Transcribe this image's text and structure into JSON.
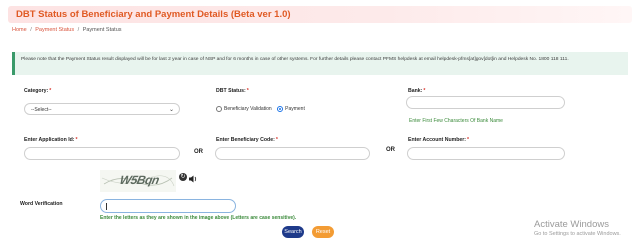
{
  "page": {
    "title": "DBT Status of Beneficiary and Payment Details (Beta ver 1.0)"
  },
  "breadcrumb": {
    "items": [
      "Home",
      "Payment Status",
      "Payment Status"
    ],
    "separator": "/"
  },
  "notice": {
    "text": "Please note that the Payment Status result displayed will be for last 2 year in case of NSP and for 6 months in case of other systems. For further details please contact PFMS helpdesk at email helpdesk-pfms[at]gov[dot]in and Helpdesk No. 1800 118 111."
  },
  "form": {
    "category": {
      "label": "Category:",
      "required_mark": "*",
      "value": "--Select--"
    },
    "dbt_status": {
      "label": "DBT Status:",
      "required_mark": "*",
      "options": [
        "Beneficiary Validation",
        "Payment"
      ],
      "selected": "Payment"
    },
    "bank": {
      "label": "Bank:",
      "required_mark": "*",
      "hint": "Enter First Few Characters Of Bank Name",
      "value": ""
    },
    "application_id": {
      "label": "Enter Application Id:",
      "required_mark": "*",
      "value": ""
    },
    "beneficiary_code": {
      "label": "Enter Beneficiary Code:",
      "required_mark": "*",
      "value": ""
    },
    "account_number": {
      "label": "Enter Account Number:",
      "required_mark": "*",
      "value": ""
    },
    "or_label": "OR",
    "captcha": {
      "text": "W5Bqn"
    },
    "word_verification": {
      "label": "Word Verification",
      "value": "",
      "hint": "Enter the letters as they are shown in the image above (Letters are case sensitive)."
    },
    "buttons": {
      "search": "Search",
      "reset": "Reset"
    }
  },
  "colors": {
    "title": "#e05a24",
    "notice_bg": "#e8f4ee",
    "notice_border": "#3a9a6a",
    "search_button": "#1e3a8a",
    "reset_button": "#f39c34",
    "hint_green": "#3a8a3a"
  },
  "os_watermark": {
    "title": "Activate Windows",
    "subtitle": "Go to Settings to activate Windows."
  }
}
